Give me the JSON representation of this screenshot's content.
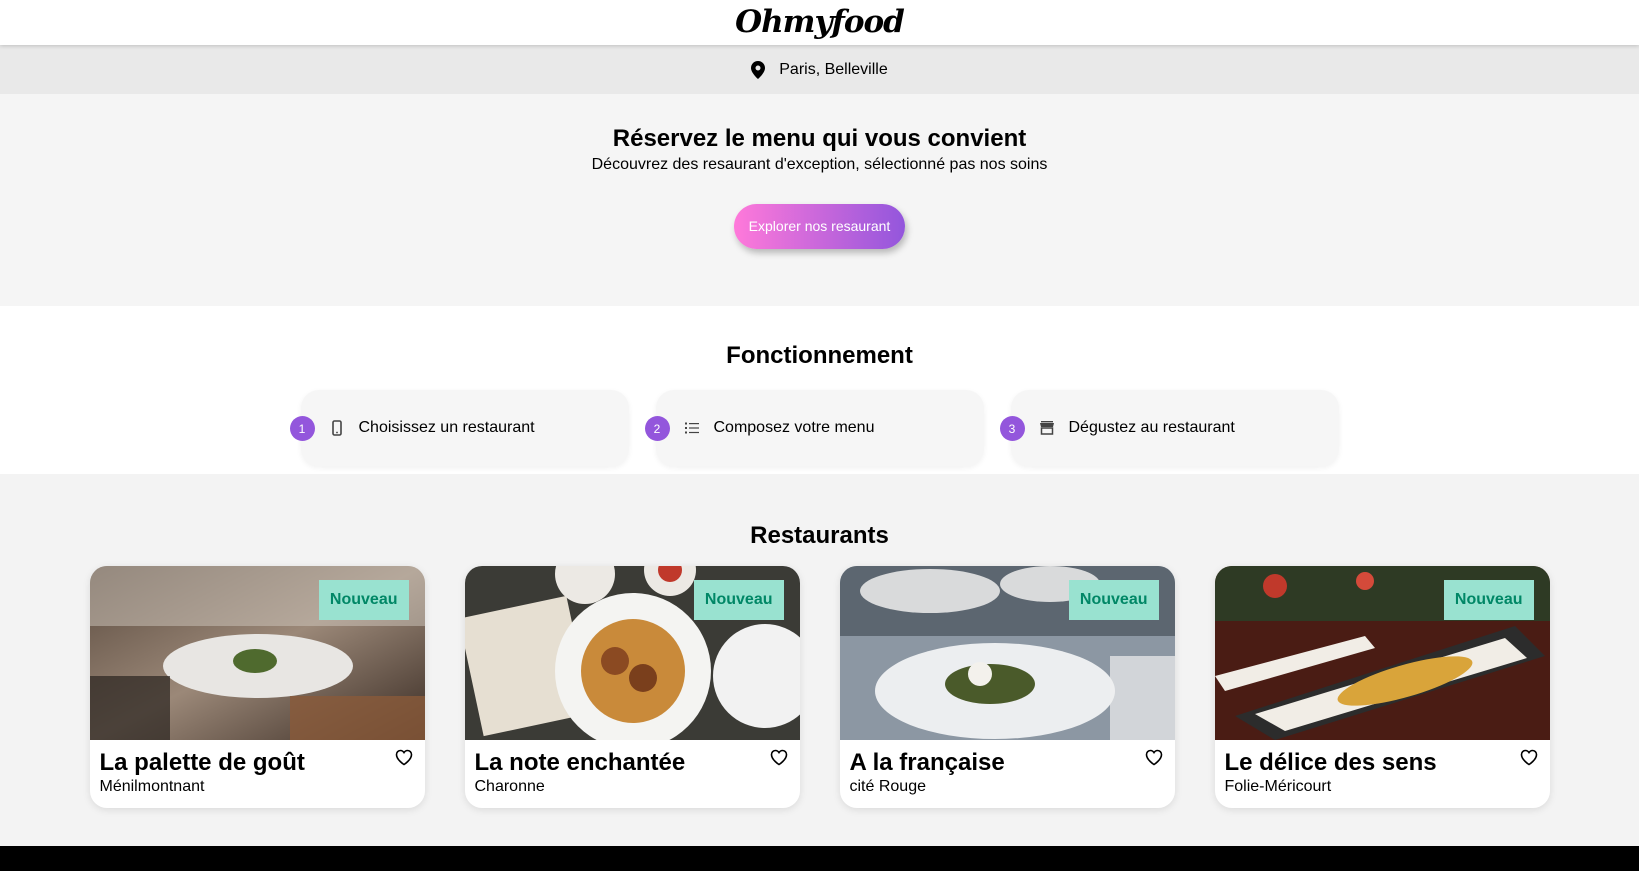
{
  "header": {
    "logo": "Ohmyfood"
  },
  "location": {
    "text": "Paris, Belleville",
    "icon": "map-pin-icon"
  },
  "hero": {
    "title": "Réservez le menu qui vous convient",
    "subtitle": "Découvrez des resaurant d'exception, sélectionné pas nos soins",
    "cta_label": "Explorer nos resaurant"
  },
  "how": {
    "title": "Fonctionnement",
    "steps": [
      {
        "num": "1",
        "icon": "mobile-icon",
        "label": "Choisissez un restaurant"
      },
      {
        "num": "2",
        "icon": "list-icon",
        "label": "Composez votre menu"
      },
      {
        "num": "3",
        "icon": "store-icon",
        "label": "Dégustez au restaurant"
      }
    ]
  },
  "restaurants": {
    "title": "Restaurants",
    "items": [
      {
        "name": "La palette de goût",
        "area": "Ménilmontnant",
        "badge": "Nouveau"
      },
      {
        "name": "La note enchantée",
        "area": "Charonne",
        "badge": "Nouveau"
      },
      {
        "name": "A la française",
        "area": "cité Rouge",
        "badge": "Nouveau"
      },
      {
        "name": "Le délice des sens",
        "area": "Folie-Méricourt",
        "badge": "Nouveau"
      }
    ]
  },
  "colors": {
    "accent_start": "#ff79da",
    "accent_end": "#9356dc",
    "badge_bg": "#99e2d0",
    "badge_text": "#008766"
  }
}
